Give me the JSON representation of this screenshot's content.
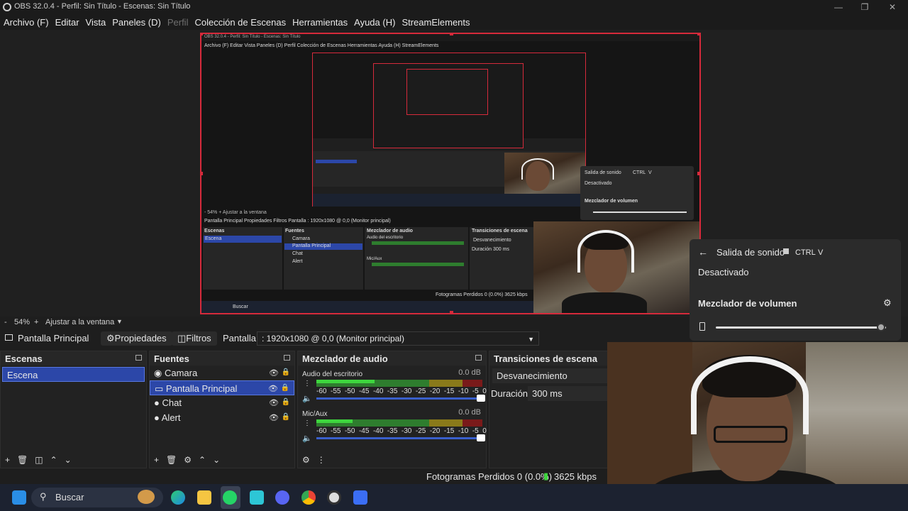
{
  "window": {
    "title": "OBS 32.0.4 - Perfil: Sin Título - Escenas: Sin Título"
  },
  "menu": [
    {
      "label": "Archivo (F)",
      "disabled": false
    },
    {
      "label": "Editar",
      "disabled": false
    },
    {
      "label": "Vista",
      "disabled": false
    },
    {
      "label": "Paneles (D)",
      "disabled": false
    },
    {
      "label": "Perfil",
      "disabled": true
    },
    {
      "label": "Colección de Escenas",
      "disabled": false
    },
    {
      "label": "Herramientas",
      "disabled": false
    },
    {
      "label": "Ayuda (H)",
      "disabled": false
    },
    {
      "label": "StreamElements",
      "disabled": false
    }
  ],
  "zoom": {
    "minus": "-",
    "value": "54%",
    "plus": "+",
    "fit_label": "Ajustar a la ventana"
  },
  "source_toolbar": {
    "selected_source": "Pantalla Principal",
    "properties": "Propiedades",
    "filters": "Filtros",
    "display_label": "Pantalla",
    "display_value": ": 1920x1080 @ 0,0 (Monitor principal)"
  },
  "scenes": {
    "title": "Escenas",
    "items": [
      "Escena"
    ]
  },
  "sources": {
    "title": "Fuentes",
    "items": [
      {
        "label": "Camara",
        "icon": "camera-icon"
      },
      {
        "label": "Pantalla Principal",
        "icon": "monitor-icon"
      },
      {
        "label": "Chat",
        "icon": "globe-icon"
      },
      {
        "label": "Alert",
        "icon": "globe-icon"
      }
    ]
  },
  "mixer": {
    "title": "Mezclador de audio",
    "scale": [
      "-60",
      "-55",
      "-50",
      "-45",
      "-40",
      "-35",
      "-30",
      "-25",
      "-20",
      "-15",
      "-10",
      "-5",
      "0"
    ],
    "channels": [
      {
        "name": "Audio del escritorio",
        "db": "0.0 dB",
        "level": 0.35,
        "volume": 1.0
      },
      {
        "name": "Mic/Aux",
        "db": "0.0 dB",
        "level": 0.22,
        "volume": 1.0
      }
    ]
  },
  "transitions": {
    "title": "Transiciones de escena",
    "current": "Desvanecimiento",
    "duration_label": "Duración",
    "duration_value": "300 ms"
  },
  "status": {
    "frames": "Fotogramas Perdidos 0 (0.0%)",
    "bitrate": "3625 kbps"
  },
  "sound_flyout": {
    "title": "Salida de sonido",
    "shortcut_ctrl": "CTRL",
    "shortcut_key": "V",
    "state": "Desactivado",
    "mixer_label": "Mezclador de volumen",
    "volume": 0.97
  },
  "taskbar": {
    "search_placeholder": "Buscar"
  },
  "nested": {
    "menu": "Archivo (F)   Editar   Vista   Paneles (D)   Perfil   Colección de Escenas   Herramientas   Ayuda (H)   StreamElements",
    "title": "OBS 32.0.4 - Perfil: Sin Título - Escenas: Sin Título",
    "zoom": "- 54% + Ajustar a la ventana",
    "toolbar": "Pantalla Principal    Propiedades    Filtros    Pantalla : 1920x1080 @ 0,0 (Monitor principal)",
    "scenes": "Escenas",
    "scene_item": "Escena",
    "sources": "Fuentes",
    "mixer": "Mezclador de audio",
    "transitions": "Transiciones de escena",
    "src1": "Camara",
    "src2": "Pantalla Principal",
    "src3": "Chat",
    "src4": "Alert",
    "audio1": "Audio del escritorio",
    "audio2": "Mic/Aux",
    "fade": "Desvanecimiento",
    "duration": "Duración    300 ms",
    "status": "Fotogramas Perdidos 0 (0.0%)   3625 kbps",
    "search": "Buscar",
    "flyout_title": "Salida de sonido",
    "flyout_ctrl": "CTRL",
    "flyout_key": "V",
    "flyout_state": "Desactivado",
    "flyout_mixer": "Mezclador de volumen"
  },
  "colors": {
    "selection": "#2c47a8",
    "preview_border": "#d62a3b",
    "meter_green": "#3ed63e"
  }
}
